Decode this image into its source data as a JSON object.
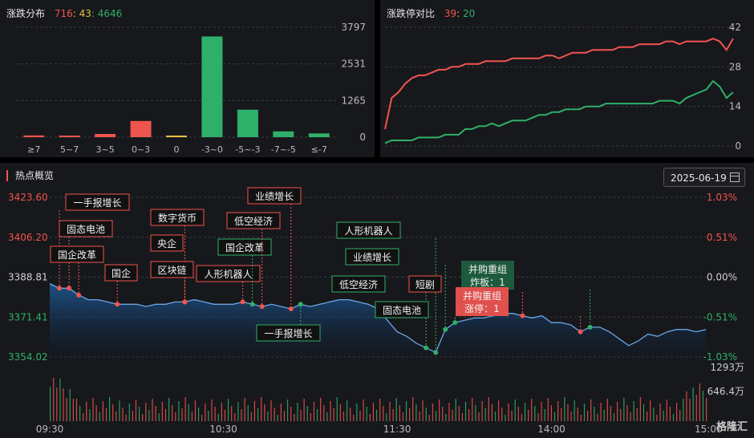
{
  "distribution": {
    "title": "涨跌分布",
    "up_count": "716",
    "flat_count": "43",
    "down_count": "4646",
    "sep": ":"
  },
  "ratio": {
    "title": "涨跌停对比",
    "limit_up": "39",
    "limit_down": "20",
    "sep": ":"
  },
  "hot": {
    "title": "热点概览",
    "date": "2025-06-19",
    "volume_labels": [
      "1293万",
      "646.4万"
    ],
    "logo": "格隆汇"
  },
  "colors": {
    "up": "#f0544f",
    "down": "#2fb06a",
    "flat": "#e8c040",
    "grid": "#3a3b40",
    "bg": "#17181b"
  },
  "chart_data": [
    {
      "type": "bar",
      "categories": [
        "≥7",
        "5~7",
        "3~5",
        "0~3",
        "0",
        "-3~0",
        "-5~-3",
        "-7~-5",
        "≤-7"
      ],
      "values": [
        60,
        40,
        110,
        560,
        43,
        3480,
        950,
        200,
        130
      ],
      "ylim": [
        0,
        3797
      ],
      "yticks": [
        0,
        1265,
        2531,
        3797
      ]
    },
    {
      "type": "line",
      "yticks": [
        0,
        14,
        28,
        42
      ],
      "ylim": [
        0,
        42
      ],
      "series": [
        {
          "values": [
            6,
            17,
            19,
            22,
            24,
            25,
            25,
            26,
            27,
            27,
            28,
            28,
            29,
            29,
            29,
            30,
            30,
            30,
            30,
            31,
            31,
            31,
            31,
            31,
            32,
            32,
            31,
            32,
            33,
            33,
            33,
            34,
            34,
            34,
            34,
            35,
            35,
            35,
            36,
            36,
            36,
            36,
            37,
            37,
            36,
            37,
            37,
            37,
            37,
            38,
            37,
            34,
            38
          ]
        },
        {
          "values": [
            1,
            2,
            2,
            2,
            2,
            3,
            3,
            3,
            3,
            4,
            4,
            4,
            6,
            6,
            7,
            7,
            8,
            7,
            8,
            9,
            9,
            9,
            10,
            11,
            11,
            12,
            12,
            13,
            13,
            13,
            14,
            14,
            14,
            15,
            15,
            15,
            15,
            15,
            15,
            15,
            15,
            16,
            16,
            16,
            15,
            17,
            18,
            19,
            20,
            23,
            21,
            17,
            19
          ]
        }
      ]
    },
    {
      "type": "area",
      "x": [
        "09:30",
        "10:30",
        "11:30",
        "14:00",
        "15:00"
      ],
      "yticks_left": [
        "3423.60",
        "3406.20",
        "3388.81",
        "3371.41",
        "3354.02"
      ],
      "yticks_right": [
        "1.03%",
        "0.51%",
        "0.00%",
        "-0.51%",
        "-1.03%"
      ],
      "ylim": [
        3354.02,
        3423.6
      ],
      "values": [
        3386,
        3384,
        3384,
        3381,
        3379,
        3379,
        3378,
        3377,
        3377,
        3377,
        3376,
        3377,
        3377,
        3378,
        3378,
        3379,
        3378,
        3377,
        3377,
        3377,
        3378,
        3377,
        3376,
        3377,
        3376,
        3375,
        3377,
        3376,
        3377,
        3378,
        3379,
        3379,
        3378,
        3377,
        3375,
        3370,
        3365,
        3363,
        3360,
        3358,
        3356,
        3366,
        3369,
        3370,
        3371,
        3371,
        3372,
        3373,
        3373,
        3372,
        3371,
        3372,
        3369,
        3369,
        3368,
        3365,
        3367,
        3367,
        3365,
        3362,
        3359,
        3361,
        3364,
        3363,
        3365,
        3366,
        3366,
        3365,
        3366
      ],
      "annotations": [
        {
          "label": "一手报增长",
          "trend": "up",
          "xi": 1,
          "anchor": "above"
        },
        {
          "label": "固态电池",
          "trend": "up",
          "xi": 2,
          "anchor": "above"
        },
        {
          "label": "国企改革",
          "trend": "up",
          "xi": 3,
          "anchor": "above"
        },
        {
          "label": "国企",
          "trend": "up",
          "xi": 7,
          "anchor": "above"
        },
        {
          "label": "数字货币",
          "trend": "up",
          "xi": 14,
          "anchor": "above"
        },
        {
          "label": "央企",
          "trend": "up",
          "xi": 14,
          "anchor": "above"
        },
        {
          "label": "区块链",
          "trend": "up",
          "xi": 14,
          "anchor": "above"
        },
        {
          "label": "人形机器人",
          "trend": "up",
          "xi": 20,
          "anchor": "above"
        },
        {
          "label": "国企改革",
          "trend": "down",
          "xi": 21,
          "anchor": "above"
        },
        {
          "label": "低空经济",
          "trend": "up",
          "xi": 22,
          "anchor": "above"
        },
        {
          "label": "业绩增长",
          "trend": "up",
          "xi": 25,
          "anchor": "above"
        },
        {
          "label": "一手报增长",
          "trend": "down",
          "xi": 26,
          "anchor": "below"
        },
        {
          "label": "人形机器人",
          "trend": "down",
          "xi": 40,
          "anchor": "above"
        },
        {
          "label": "低空经济",
          "trend": "down",
          "xi": 39,
          "anchor": "above"
        },
        {
          "label": "业绩增长",
          "trend": "down",
          "xi": 41,
          "anchor": "above"
        },
        {
          "label": "固态电池",
          "trend": "down",
          "xi": 42,
          "anchor": "above"
        },
        {
          "label": "短剧",
          "trend": "up",
          "xi": 49,
          "anchor": "above"
        },
        {
          "label": "并购重组\n炸板：1",
          "trend": "down",
          "xi": 56,
          "anchor": "above"
        },
        {
          "label": "并购重组\n涨停：1",
          "trend": "up",
          "xi": 55,
          "anchor": "above"
        }
      ]
    }
  ]
}
